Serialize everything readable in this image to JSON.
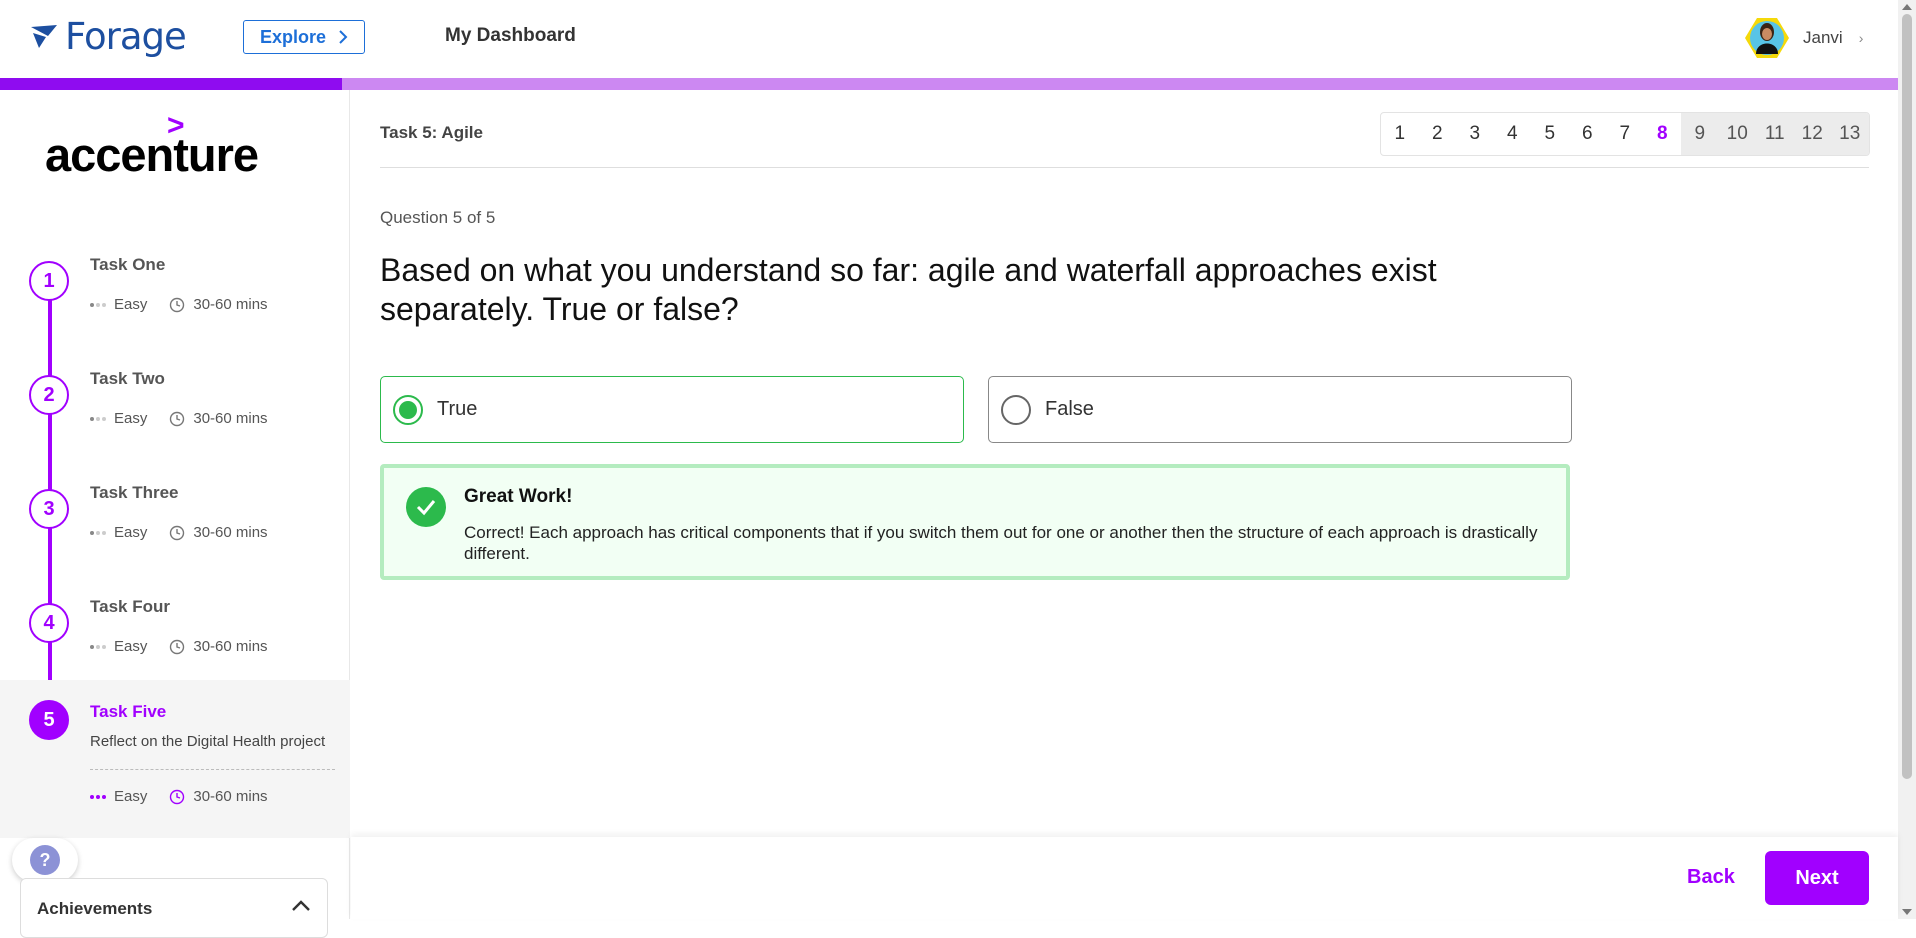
{
  "header": {
    "logo_text": "Forage",
    "explore_label": "Explore",
    "dashboard_label": "My Dashboard",
    "user_name": "Janvi"
  },
  "progress": {
    "fraction": 0.18
  },
  "sidebar": {
    "company": "accenture",
    "tasks": [
      {
        "number": "1",
        "title": "Task One",
        "difficulty": "Easy",
        "duration": "30-60 mins"
      },
      {
        "number": "2",
        "title": "Task Two",
        "difficulty": "Easy",
        "duration": "30-60 mins"
      },
      {
        "number": "3",
        "title": "Task Three",
        "difficulty": "Easy",
        "duration": "30-60 mins"
      },
      {
        "number": "4",
        "title": "Task Four",
        "difficulty": "Easy",
        "duration": "30-60 mins"
      },
      {
        "number": "5",
        "title": "Task Five",
        "description": "Reflect on the Digital Health project",
        "difficulty": "Easy",
        "duration": "30-60 mins"
      }
    ],
    "achievements_label": "Achievements",
    "help_label": "?"
  },
  "main": {
    "task_label": "Task 5: Agile",
    "pages": [
      "1",
      "2",
      "3",
      "4",
      "5",
      "6",
      "7",
      "8",
      "9",
      "10",
      "11",
      "12",
      "13"
    ],
    "current_page": "8",
    "question_count": "Question 5 of 5",
    "question": "Based on what you understand so far: agile and waterfall approaches exist separately. True or false?",
    "options": [
      {
        "label": "True",
        "selected": true
      },
      {
        "label": "False",
        "selected": false
      }
    ],
    "feedback": {
      "title": "Great Work!",
      "body": "Correct! Each approach has critical components that if you switch them out for one or another then the structure of each approach is drastically different."
    }
  },
  "footer": {
    "back_label": "Back",
    "next_label": "Next"
  },
  "colors": {
    "brand_purple": "#a100ff",
    "forage_blue": "#1d4fa0",
    "success_green": "#2cba4c"
  }
}
